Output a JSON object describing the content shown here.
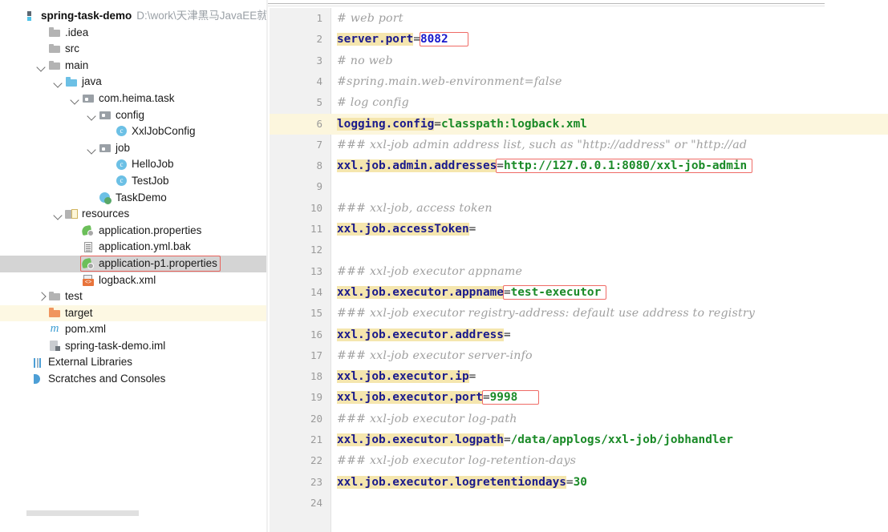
{
  "project": {
    "name": "spring-task-demo",
    "path": "D:\\work\\天津黑马JavaEE就业"
  },
  "sidebar": {
    "items": [
      {
        "label": ".idea",
        "depth": 1,
        "arrow": "none",
        "icon": "folder-icon"
      },
      {
        "label": "src",
        "depth": 1,
        "arrow": "none",
        "icon": "folder-icon"
      },
      {
        "label": "main",
        "depth": 1,
        "arrow": "expanded",
        "icon": "folder-icon"
      },
      {
        "label": "java",
        "depth": 2,
        "arrow": "expanded",
        "icon": "source-folder-icon"
      },
      {
        "label": "com.heima.task",
        "depth": 3,
        "arrow": "expanded",
        "icon": "package-icon"
      },
      {
        "label": "config",
        "depth": 4,
        "arrow": "expanded",
        "icon": "package-icon"
      },
      {
        "label": "XxlJobConfig",
        "depth": 5,
        "arrow": "none",
        "icon": "java-class-icon"
      },
      {
        "label": "job",
        "depth": 4,
        "arrow": "expanded",
        "icon": "package-icon"
      },
      {
        "label": "HelloJob",
        "depth": 5,
        "arrow": "none",
        "icon": "java-class-icon"
      },
      {
        "label": "TestJob",
        "depth": 5,
        "arrow": "none",
        "icon": "java-class-icon"
      },
      {
        "label": "TaskDemo",
        "depth": 4,
        "arrow": "none",
        "icon": "runnable-class-icon"
      },
      {
        "label": "resources",
        "depth": 2,
        "arrow": "expanded",
        "icon": "resources-folder-icon"
      },
      {
        "label": "application.properties",
        "depth": 3,
        "arrow": "none",
        "icon": "properties-file-icon"
      },
      {
        "label": "application.yml.bak",
        "depth": 3,
        "arrow": "none",
        "icon": "text-file-icon"
      },
      {
        "label": "application-p1.properties",
        "depth": 3,
        "arrow": "none",
        "icon": "properties-file-icon",
        "selected": true,
        "outlined": true
      },
      {
        "label": "logback.xml",
        "depth": 3,
        "arrow": "none",
        "icon": "xml-file-icon"
      },
      {
        "label": "test",
        "depth": 1,
        "arrow": "collapsed",
        "icon": "folder-icon"
      },
      {
        "label": "target",
        "depth": 1,
        "arrow": "none",
        "icon": "excluded-folder-icon",
        "excluded": true
      },
      {
        "label": "pom.xml",
        "depth": 1,
        "arrow": "none",
        "icon": "maven-file-icon"
      },
      {
        "label": "spring-task-demo.iml",
        "depth": 1,
        "arrow": "none",
        "icon": "module-file-icon"
      },
      {
        "label": "External Libraries",
        "depth": 0,
        "arrow": "none",
        "icon": "external-libraries-icon"
      },
      {
        "label": "Scratches and Consoles",
        "depth": 0,
        "arrow": "none",
        "icon": "scratches-icon"
      }
    ]
  },
  "editor": {
    "caret_line": 6,
    "lines": [
      {
        "n": 1,
        "type": "comment",
        "comment": "# web port"
      },
      {
        "n": 2,
        "type": "property",
        "key": "server.port",
        "value": "8082",
        "value_color": "blue",
        "boxed": "value"
      },
      {
        "n": 3,
        "type": "comment",
        "comment": "# no web"
      },
      {
        "n": 4,
        "type": "comment",
        "comment": "#spring.main.web-environment=false"
      },
      {
        "n": 5,
        "type": "comment",
        "comment": "# log config"
      },
      {
        "n": 6,
        "type": "property",
        "key": "logging.config",
        "value": "classpath:logback.xml"
      },
      {
        "n": 7,
        "type": "comment",
        "comment": "### xxl-job admin address list, such as \"http://address\" or \"http://ad"
      },
      {
        "n": 8,
        "type": "property",
        "key": "xxl.job.admin.addresses",
        "value": "http://127.0.0.1:8080/xxl-job-admin",
        "boxed": "eq-value"
      },
      {
        "n": 9,
        "type": "blank"
      },
      {
        "n": 10,
        "type": "comment",
        "comment": "### xxl-job, access token"
      },
      {
        "n": 11,
        "type": "property",
        "key": "xxl.job.accessToken",
        "value": ""
      },
      {
        "n": 12,
        "type": "blank"
      },
      {
        "n": 13,
        "type": "comment",
        "comment": "### xxl-job executor appname"
      },
      {
        "n": 14,
        "type": "property",
        "key": "xxl.job.executor.appname",
        "value": "test-executor",
        "boxed": "eq-value"
      },
      {
        "n": 15,
        "type": "comment",
        "comment": "### xxl-job executor registry-address: default use address to registry"
      },
      {
        "n": 16,
        "type": "property",
        "key": "xxl.job.executor.address",
        "value": ""
      },
      {
        "n": 17,
        "type": "comment",
        "comment": "### xxl-job executor server-info"
      },
      {
        "n": 18,
        "type": "property",
        "key": "xxl.job.executor.ip",
        "value": ""
      },
      {
        "n": 19,
        "type": "property",
        "key": "xxl.job.executor.port",
        "value": "9998",
        "boxed": "eq-value"
      },
      {
        "n": 20,
        "type": "comment",
        "comment": "### xxl-job executor log-path"
      },
      {
        "n": 21,
        "type": "property",
        "key": "xxl.job.executor.logpath",
        "value": "/data/applogs/xxl-job/jobhandler"
      },
      {
        "n": 22,
        "type": "comment",
        "comment": "### xxl-job executor log-retention-days"
      },
      {
        "n": 23,
        "type": "property",
        "key": "xxl.job.executor.logretentiondays",
        "value": "30"
      },
      {
        "n": 24,
        "type": "blank"
      }
    ]
  },
  "colors": {
    "key": "#1a1a8c",
    "value": "#1a8a27",
    "value_blue": "#1818cc",
    "comment": "#a0a0a0",
    "key_highlight": "#f5e6ae",
    "caret_line": "#fcf6dd",
    "annotation_box": "#ef6b66",
    "selection": "#d4d4d4",
    "excluded": "#fdf8e3"
  }
}
